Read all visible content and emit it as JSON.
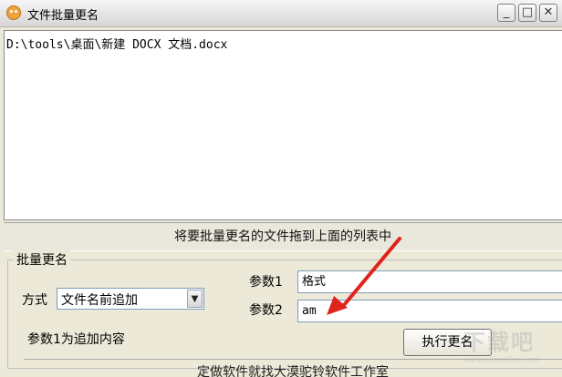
{
  "window": {
    "title": "文件批量更名",
    "controls": {
      "minimize": "_",
      "maximize": "□",
      "close": "✕"
    }
  },
  "file_list": {
    "items": [
      "D:\\tools\\桌面\\新建 DOCX 文档.docx"
    ]
  },
  "hint": "将要批量更名的文件拖到上面的列表中",
  "batch_group": {
    "title": "批量更名",
    "mode_label": "方式",
    "mode_value": "文件名前追加",
    "param1_label": "参数1",
    "param1_value": "格式",
    "param2_label": "参数2",
    "param2_value": "am",
    "param_hint": "参数1为追加内容",
    "execute_label": "执行更名"
  },
  "footer": "定做软件就找大漠驼铃软件工作室",
  "watermark": {
    "main": "下载吧",
    "sub": "www.xiazaiba.com"
  },
  "annotation": {
    "arrow_color": "#e0241b"
  }
}
